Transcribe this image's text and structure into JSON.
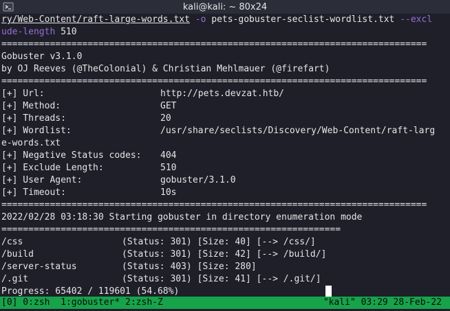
{
  "window": {
    "title": "kali@kali: ~ 80x24"
  },
  "terminal": {
    "cmd_line1_path": "ry/Web-Content/raft-large-words.txt",
    "cmd_line1_flag_o": "-o",
    "cmd_line1_output": "pets-gobuster-seclist-wordlist.txt",
    "cmd_line1_flag_excl": "--excl",
    "cmd_line2_flag_rest": "ude-length",
    "cmd_line2_value": " 510",
    "rule_long": "===============================================================================",
    "rule_short": "===============================================================",
    "banner_name": "Gobuster v3.1.0",
    "banner_authors": "by OJ Reeves (@TheColonial) & Christian Mehlmauer (@firefart)",
    "config": [
      {
        "label": "[+] Url:",
        "value": "http://pets.devzat.htb/"
      },
      {
        "label": "[+] Method:",
        "value": "GET"
      },
      {
        "label": "[+] Threads:",
        "value": "20"
      },
      {
        "label": "[+] Wordlist:",
        "value": "/usr/share/seclists/Discovery/Web-Content/raft-larg"
      },
      {
        "label": "e-words.txt",
        "value": ""
      },
      {
        "label": "[+] Negative Status codes:",
        "value": "404"
      },
      {
        "label": "[+] Exclude Length:",
        "value": "510"
      },
      {
        "label": "[+] User Agent:",
        "value": "gobuster/3.1.0"
      },
      {
        "label": "[+] Timeout:",
        "value": "10s"
      }
    ],
    "start_msg": "2022/02/28 03:18:30 Starting gobuster in directory enumeration mode",
    "results": [
      {
        "path": "/css",
        "info": "(Status: 301) [Size: 40] [--> /css/]"
      },
      {
        "path": "/build",
        "info": "(Status: 301) [Size: 42] [--> /build/]"
      },
      {
        "path": "/server-status",
        "info": "(Status: 403) [Size: 280]"
      },
      {
        "path": "/.git",
        "info": "(Status: 301) [Size: 41] [--> /.git/]"
      }
    ],
    "progress": "Progress: 65402 / 119601 (54.68%)"
  },
  "tmux": {
    "windows": "[0] 0:zsh  1:gobuster* 2:zsh-Z",
    "right": "\"kali\" 03:29 28-Feb-22"
  },
  "colors": {
    "background": "#1e1f29",
    "text": "#e6e6e6",
    "flag": "#9a6fd6",
    "status_bar": "#17a34a"
  }
}
